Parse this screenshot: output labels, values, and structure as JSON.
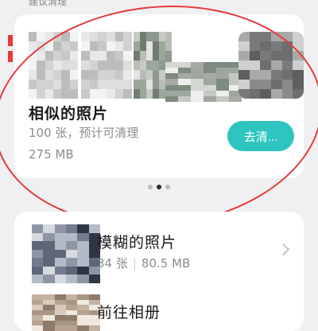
{
  "section": {
    "title": "建议清理"
  },
  "similar": {
    "title": "相似的照片",
    "count_text": "100 张，预计可清理",
    "size_text": "275 MB",
    "button_label": "去清..."
  },
  "pager": {
    "count": 3,
    "active": 1
  },
  "list": [
    {
      "title": "模糊的照片",
      "count": "34 张",
      "size": "80.5 MB"
    },
    {
      "title": "前往相册"
    }
  ],
  "colors": {
    "accent": "#2fc4c0",
    "annotation": "#e33b3b"
  }
}
